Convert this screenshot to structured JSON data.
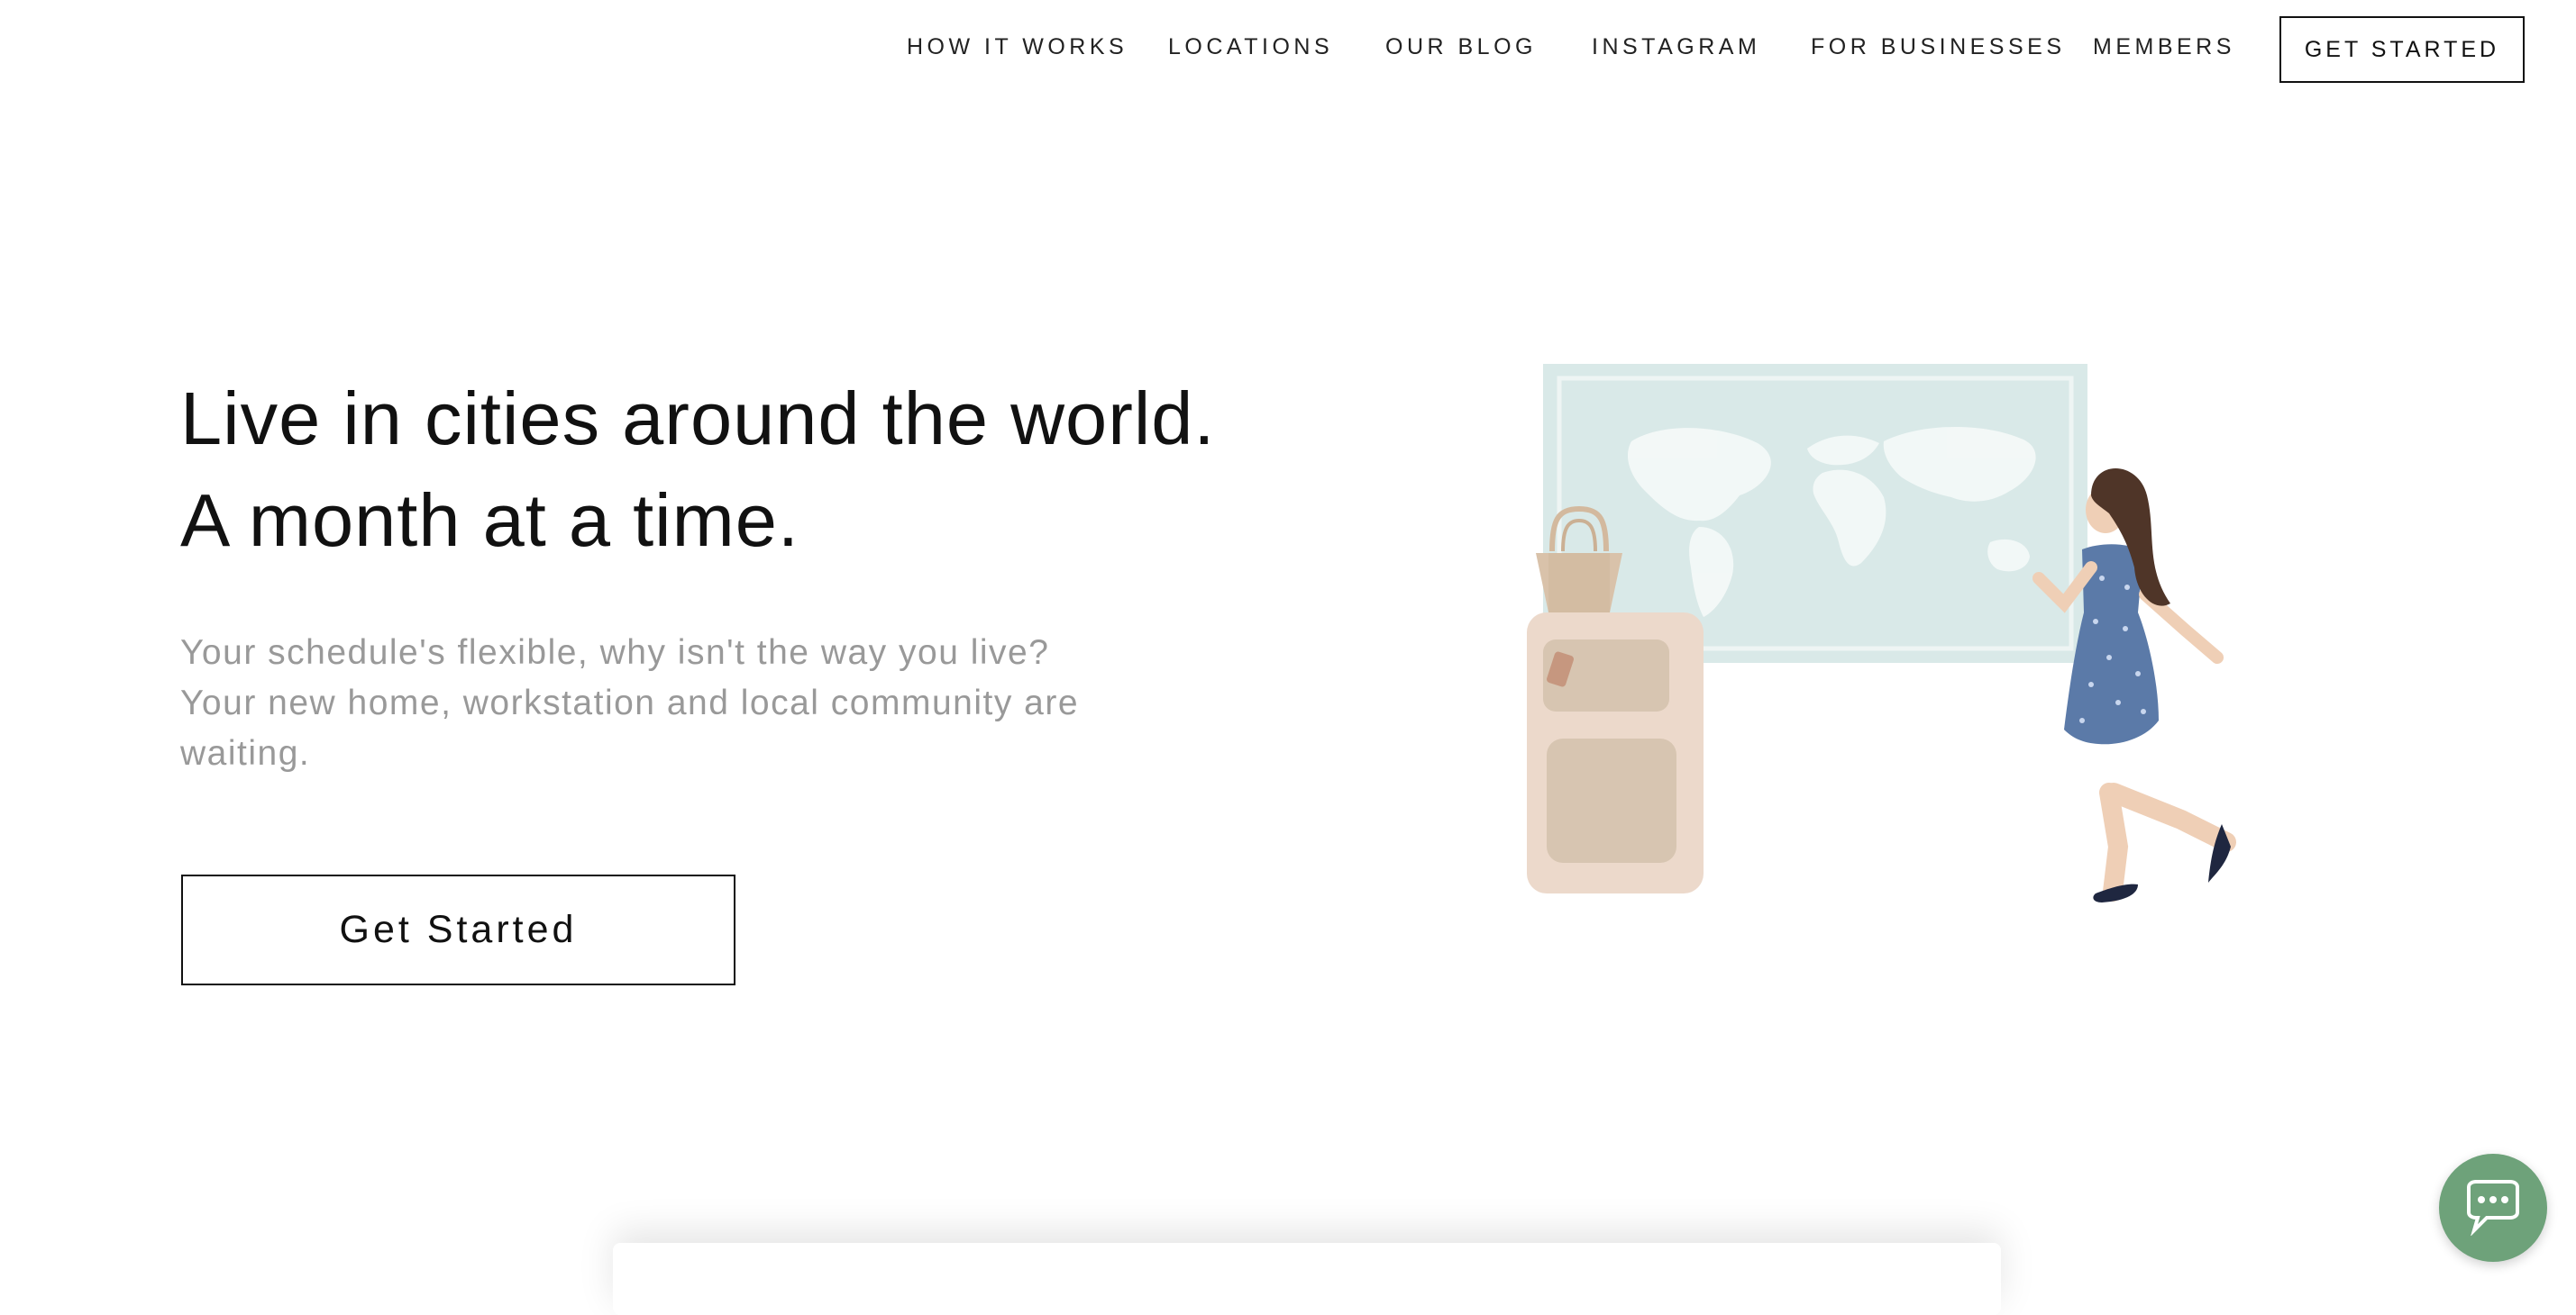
{
  "nav": {
    "links": [
      "HOW IT WORKS",
      "LOCATIONS",
      "OUR BLOG",
      "INSTAGRAM",
      "FOR BUSINESSES",
      "MEMBERS"
    ],
    "cta_label": "GET STARTED"
  },
  "hero": {
    "title_line1": "Live in cities around the world.",
    "title_line2": "A month at a time.",
    "sub_line1": "Your schedule's flexible, why isn't the way you live?",
    "sub_line2": "Your new home, workstation and local community are",
    "sub_line3": "waiting.",
    "button_label": "Get Started"
  },
  "chat": {
    "icon": "chat-bubble-icon"
  },
  "colors": {
    "map_bg": "#d9e9e8",
    "dress": "#5b7aa8",
    "suitcase": "#ecd9cb",
    "chat_bg": "#6ea27a"
  }
}
